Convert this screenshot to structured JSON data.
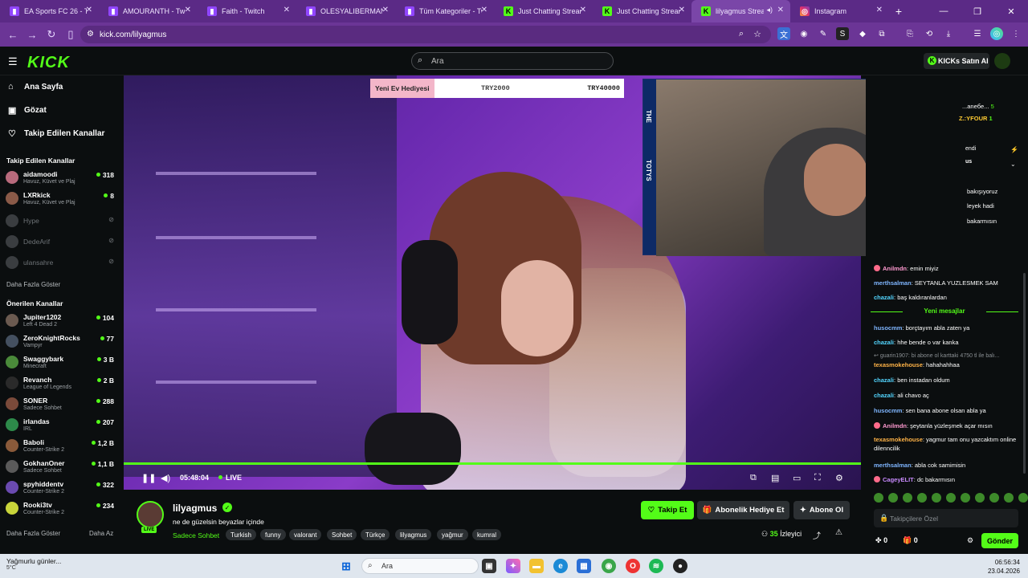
{
  "browser": {
    "tabs": [
      {
        "title": "EA Sports FC 26 - Twitch",
        "favicon": "twitch-icon"
      },
      {
        "title": "AMOURANTH - Twitch",
        "favicon": "twitch-icon"
      },
      {
        "title": "Faith - Twitch",
        "favicon": "twitch-icon"
      },
      {
        "title": "OLESYALIBERMAN - Twitch",
        "favicon": "twitch-icon"
      },
      {
        "title": "Tüm Kategoriler - Twitch",
        "favicon": "twitch-icon"
      },
      {
        "title": "Just Chatting Streams",
        "favicon": "kick-icon"
      },
      {
        "title": "Just Chatting Streams",
        "favicon": "kick-icon"
      },
      {
        "title": "lilyagmus Stream",
        "favicon": "kick-icon",
        "active": true
      },
      {
        "title": "Instagram",
        "favicon": "instagram-icon"
      }
    ],
    "url": "kick.com/lilyagmus",
    "accent": "#5b2a86"
  },
  "header": {
    "logo": "KICK",
    "search_placeholder": "Ara",
    "buy_label": "KICKs Satın Al"
  },
  "sidebar": {
    "nav": [
      {
        "label": "Ana Sayfa",
        "icon": "home-icon"
      },
      {
        "label": "Gözat",
        "icon": "browse-icon"
      },
      {
        "label": "Takip Edilen Kanallar",
        "icon": "heart-icon"
      }
    ],
    "followed_title": "Takip Edilen Kanallar",
    "followed": [
      {
        "name": "aidamoodi",
        "category": "Havuz, Küvet ve Plaj",
        "viewers": "318",
        "live": true
      },
      {
        "name": "LXRkick",
        "category": "Havuz, Küvet ve Plaj",
        "viewers": "8",
        "live": true
      },
      {
        "name": "Hype",
        "live": false
      },
      {
        "name": "DedeArif",
        "live": false
      },
      {
        "name": "ulansahre",
        "live": false
      }
    ],
    "show_more": "Daha Fazla Göster",
    "recommended_title": "Önerilen Kanallar",
    "recommended": [
      {
        "name": "Jupiter1202",
        "category": "Left 4 Dead 2",
        "viewers": "104"
      },
      {
        "name": "ZeroKnightRocks",
        "category": "Vampyr",
        "viewers": "77"
      },
      {
        "name": "Swaggybark",
        "category": "Minecraft",
        "viewers": "3 B"
      },
      {
        "name": "Revanch",
        "category": "League of Legends",
        "viewers": "2 B"
      },
      {
        "name": "SONER",
        "category": "Sadece Sohbet",
        "viewers": "288"
      },
      {
        "name": "irlandas",
        "category": "IRL",
        "viewers": "207"
      },
      {
        "name": "Baboli",
        "category": "Counter-Strike 2",
        "viewers": "1,2 B"
      },
      {
        "name": "GokhanOner",
        "category": "Sadece Sohbet",
        "viewers": "1,1 B"
      },
      {
        "name": "spyhiddentv",
        "category": "Counter-Strike 2",
        "viewers": "322"
      },
      {
        "name": "Rooki3tv",
        "category": "Counter-Strike 2",
        "viewers": "234"
      }
    ],
    "show_more2": "Daha Fazla Göster",
    "show_less": "Daha Az"
  },
  "player": {
    "gift_label": "Yeni Ev Hediyesi",
    "gift_amount1": "TRY2000",
    "gift_amount2": "TRY40000",
    "time": "05:48:04",
    "live": "LIVE",
    "cam_labels": [
      "THE",
      "TOTYS"
    ],
    "progress": 1.0
  },
  "stream": {
    "streamer": "lilyagmus",
    "title": "ne de güzelsin beyazlar içinde",
    "category": "Sadece Sohbet",
    "tags": [
      "Turkish",
      "funny",
      "valorant",
      "Sohbet",
      "Türkçe",
      "lilyagmus",
      "yağmur",
      "kumral"
    ],
    "follow_label": "Takip Et",
    "gift_sub_label": "Abonelik Hediye Et",
    "subscribe_label": "Abone Ol",
    "viewers": "35",
    "viewers_label": "İzleyici",
    "live_badge": "LIVE"
  },
  "chat": {
    "top_rows": [
      {
        "text": "...aneбe...",
        "count": "5"
      },
      {
        "text": "Z.:YFOUR",
        "count": "1"
      }
    ],
    "partial_lines": [
      "endi",
      "us",
      "bakışıyoruz",
      "leyek hadi",
      "bakarmısın"
    ],
    "messages": [
      {
        "user": "Anilmdn",
        "text": "emin miyiz",
        "color": "#ff9ad0",
        "badge": true
      },
      {
        "user": "merthsalman",
        "text": "SEYTANLA YUZLESMEK SAM",
        "color": "#7fb6ff"
      },
      {
        "user": "chazali",
        "text": "baş kaldıranlardan",
        "color": "#53d6ff"
      },
      {
        "user": "husocmm",
        "text": "borçtayım abla zaten ya",
        "color": "#7fb6ff"
      },
      {
        "user": "chazali",
        "text": "hhe bende o var kanka",
        "color": "#53d6ff"
      },
      {
        "user": "texasmokehouse",
        "text": "hahahahhaa",
        "color": "#ffb347"
      },
      {
        "user": "chazali",
        "text": "ben instadan oldum",
        "color": "#53d6ff"
      },
      {
        "user": "chazali",
        "text": "ali chavo aç",
        "color": "#53d6ff"
      },
      {
        "user": "husocmm",
        "text": "sen bana abone olsan abla ya",
        "color": "#7fb6ff"
      },
      {
        "user": "Anilmdn",
        "text": "şeytanla yüzleşmek açar mısın",
        "color": "#ff9ad0",
        "badge": true
      },
      {
        "user": "texasmokehouse",
        "text": "yagmur tam onu yazcaktım online dilenncilik",
        "color": "#ffb347"
      },
      {
        "user": "merthsalman",
        "text": "abla cok samimisin",
        "color": "#7fb6ff"
      },
      {
        "user": "CageyELIT",
        "text": "dc bakarmısın",
        "color": "#c98bff",
        "badge": true
      }
    ],
    "new_messages": "Yeni mesajlar",
    "reply_preview": "guarin1907: bi abone ol karttaki 4750 tl ile balı...",
    "input_placeholder": "Takipçilere Özel",
    "kick_count": "0",
    "gift_count": "0",
    "send_label": "Gönder"
  },
  "taskbar": {
    "weather": "Yağmurlu günler...",
    "temp": "5°C",
    "search": "Ara",
    "time": "06:56:34",
    "date": "23.04.2026"
  }
}
